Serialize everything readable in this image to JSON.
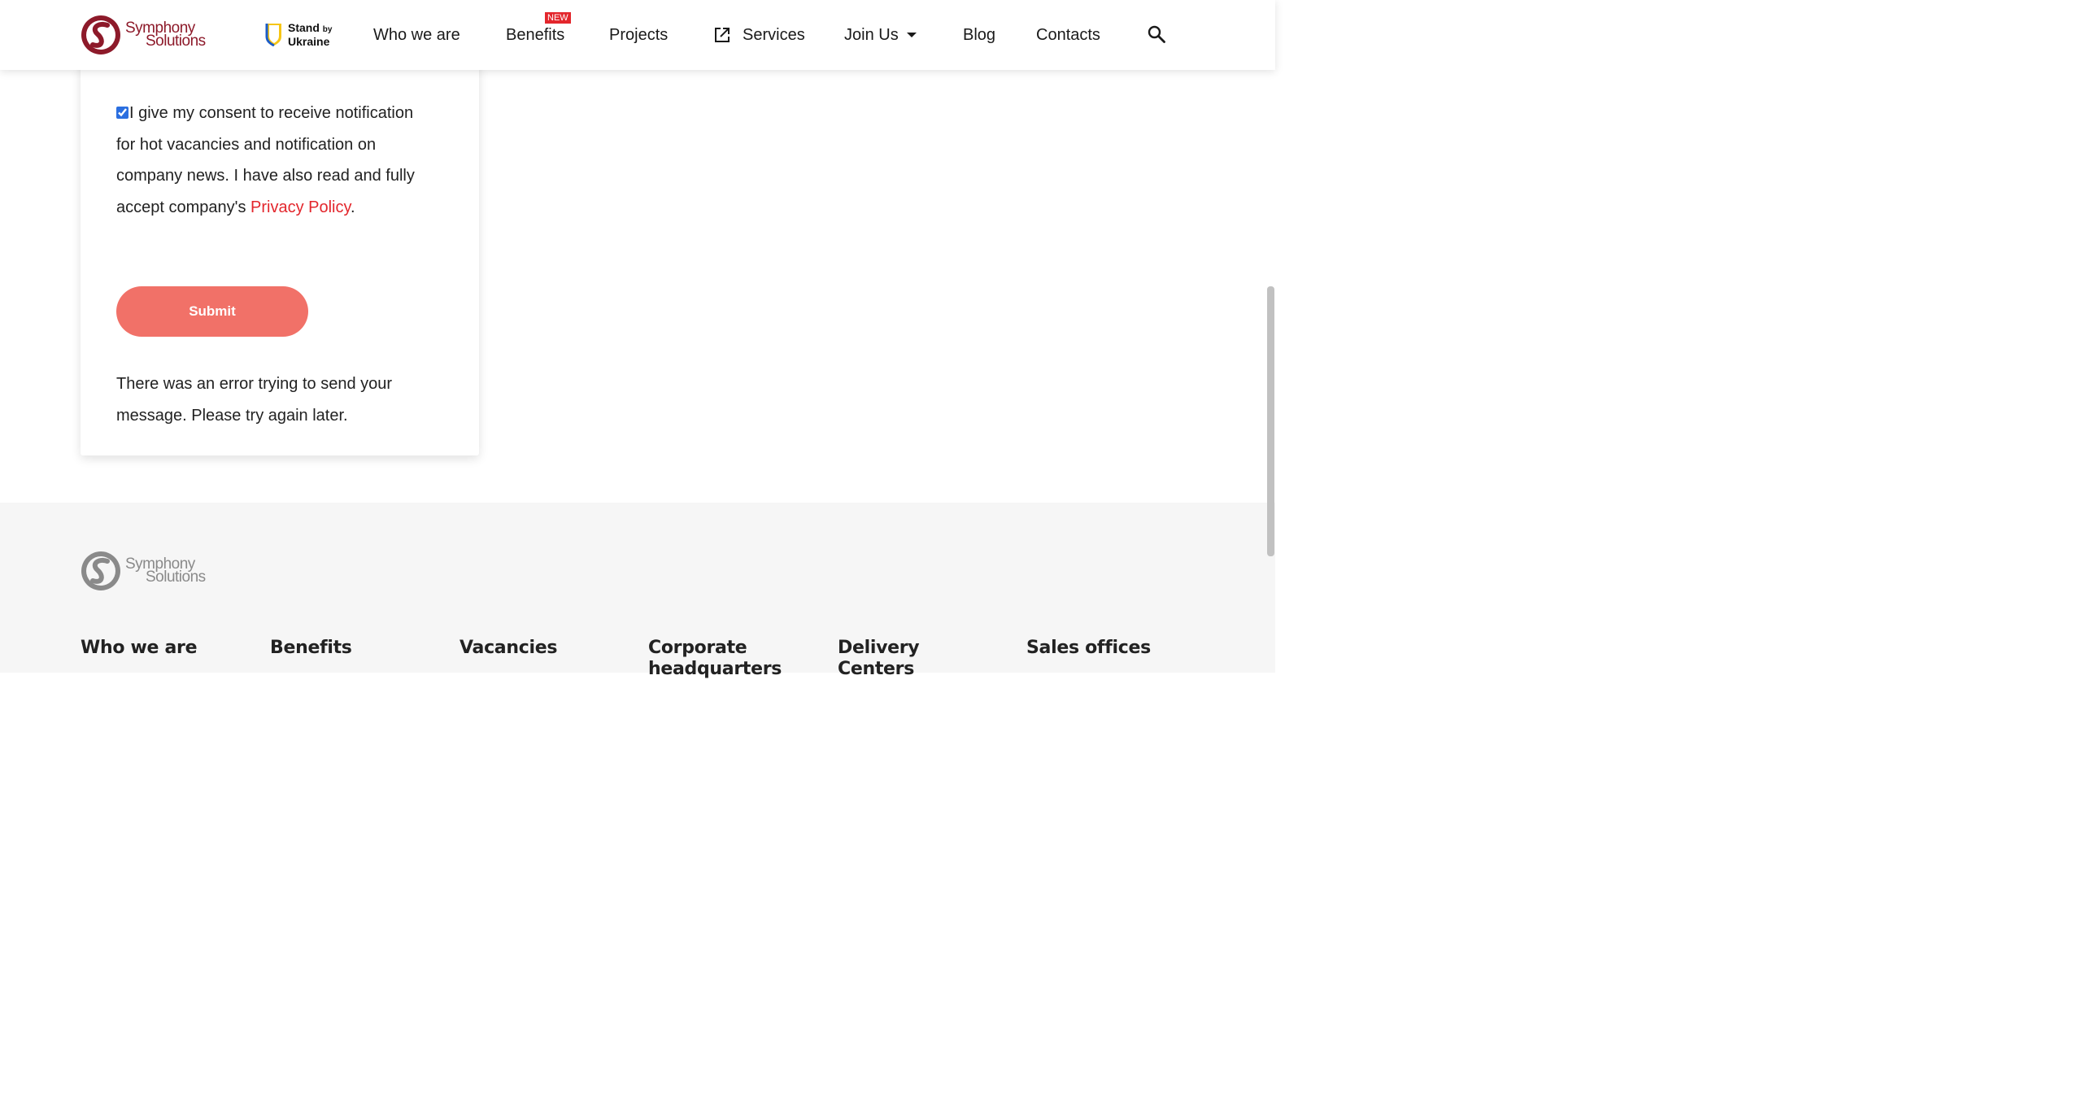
{
  "brand": {
    "logo_line1": "Symphony",
    "logo_line2": "Solutions",
    "colors": {
      "brand_red": "#8d1a2a",
      "accent_red": "#e3262c",
      "submit_button": "#f17168",
      "footer_bg": "#f6f6f6",
      "checkbox_blue": "#2b6fe0"
    }
  },
  "header": {
    "stand_line1": "Stand",
    "stand_by": "by",
    "stand_line2": "Ukraine",
    "nav": {
      "who_we_are": "Who we are",
      "benefits": "Benefits",
      "benefits_badge": "NEW",
      "projects": "Projects",
      "services": "Services",
      "join_us": "Join Us",
      "blog": "Blog",
      "contacts": "Contacts"
    },
    "icons": {
      "services": "external-link-icon",
      "join_us": "caret-down-icon",
      "search": "search-icon"
    }
  },
  "form": {
    "consent_checked": true,
    "consent_text": "I give my consent to receive notification for hot vacancies and notification on company news. I have also read and fully accept company's ",
    "privacy_link": "Privacy Policy",
    "consent_end": ".",
    "submit_label": "Submit",
    "error_message": "There was an error trying to send your message. Please try again later."
  },
  "footer": {
    "logo_line1": "Symphony",
    "logo_line2": "Solutions",
    "columns": [
      "Who we are",
      "Benefits",
      "Vacancies",
      "Corporate headquarters",
      "Delivery Centers",
      "Sales offices"
    ]
  }
}
